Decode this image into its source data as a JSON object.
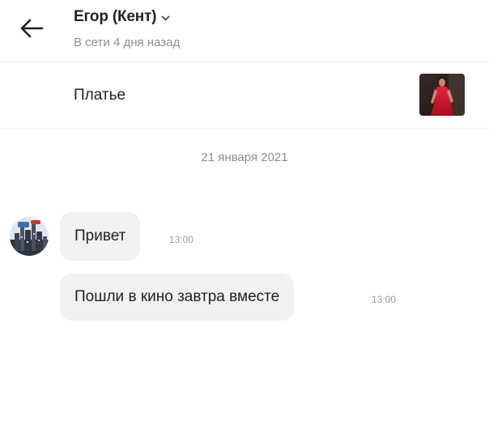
{
  "header": {
    "contact_name": "Егор (Кент)",
    "status": "В сети 4 дня назад",
    "icons": {
      "back": "arrow-left-icon",
      "expand": "chevron-down-icon"
    }
  },
  "product": {
    "title": "Платье",
    "thumbnail": "dress-photo"
  },
  "chat": {
    "date": "21 января 2021",
    "messages": [
      {
        "text": "Привет",
        "time": "13:00"
      },
      {
        "text": "Пошли в кино завтра вместе",
        "time": "13:00"
      }
    ]
  },
  "colors": {
    "bubble": "#f1f1f3",
    "secondary_text": "#8e8e93",
    "divider": "#ececee",
    "thumb_accent": "#d4152e"
  }
}
